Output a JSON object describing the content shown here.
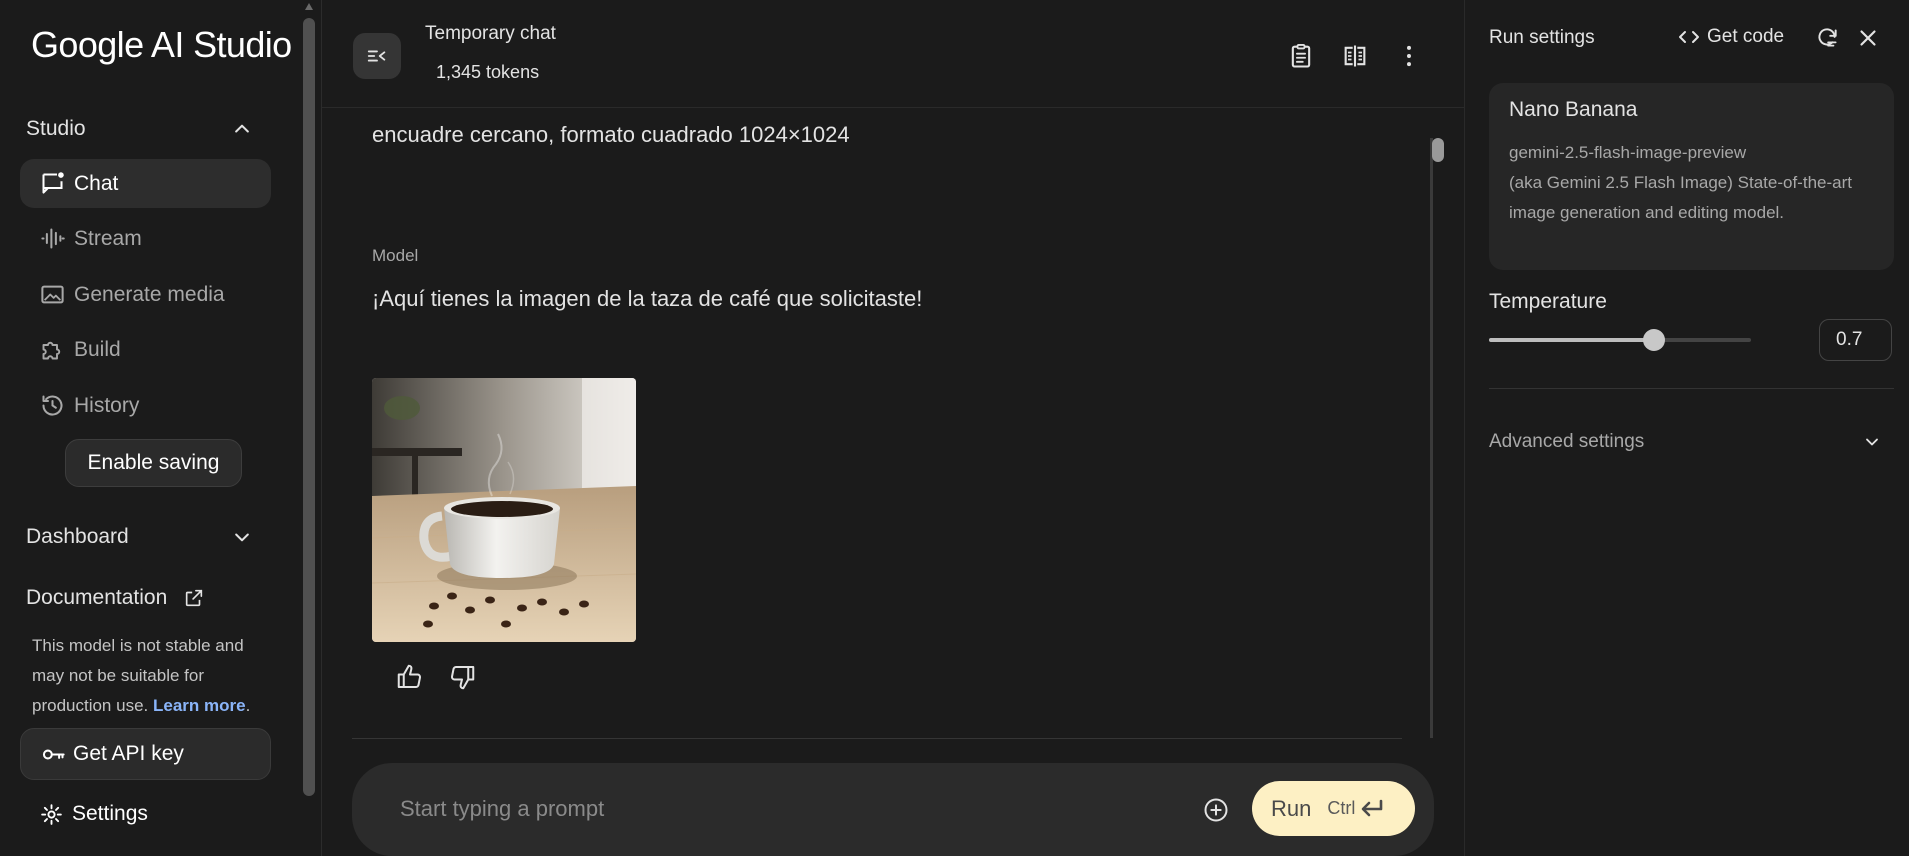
{
  "sidebar": {
    "logo": "Google AI Studio",
    "studio_header": "Studio",
    "items": [
      {
        "label": "Chat",
        "icon": "chat-bubble-icon",
        "active": true
      },
      {
        "label": "Stream",
        "icon": "waveform-icon"
      },
      {
        "label": "Generate media",
        "icon": "image-icon"
      },
      {
        "label": "Build",
        "icon": "puzzle-icon"
      },
      {
        "label": "History",
        "icon": "history-icon"
      }
    ],
    "enable_saving": "Enable saving",
    "dashboard_header": "Dashboard",
    "documentation": "Documentation",
    "notice_text": "This model is not stable and may not be suitable for production use.",
    "notice_link": "Learn more",
    "notice_period": ".",
    "get_api_key": "Get API key",
    "settings": "Settings"
  },
  "topbar": {
    "title": "Temporary chat",
    "tokens": "1,345 tokens",
    "icons": [
      "toggle-sidebar-icon",
      "clipboard-icon",
      "compare-icon",
      "more-vert-icon"
    ]
  },
  "chat": {
    "user_message_tail": "encuadre cercano, formato cuadrado 1024×1024",
    "model_label": "Model",
    "model_message": "¡Aquí tienes la imagen de la taza de café que solicitaste!",
    "image_subject": "coffee-cup-image"
  },
  "prompt": {
    "placeholder": "Start typing a prompt",
    "run_label": "Run",
    "shortcut": "Ctrl"
  },
  "run_settings": {
    "title": "Run settings",
    "get_code": "Get code",
    "model_name": "Nano Banana",
    "model_id": "gemini-2.5-flash-image-preview",
    "model_desc": "(aka Gemini 2.5 Flash Image) State-of-the-art image generation and editing model.",
    "temperature_label": "Temperature",
    "temperature_value": "0.7",
    "temperature_fraction": 0.35,
    "advanced_settings": "Advanced settings"
  },
  "colors": {
    "background": "#1b1b1b",
    "run_button": "#fdf0c4",
    "link": "#8ab4f8",
    "active_item": "#2d2d2d"
  }
}
